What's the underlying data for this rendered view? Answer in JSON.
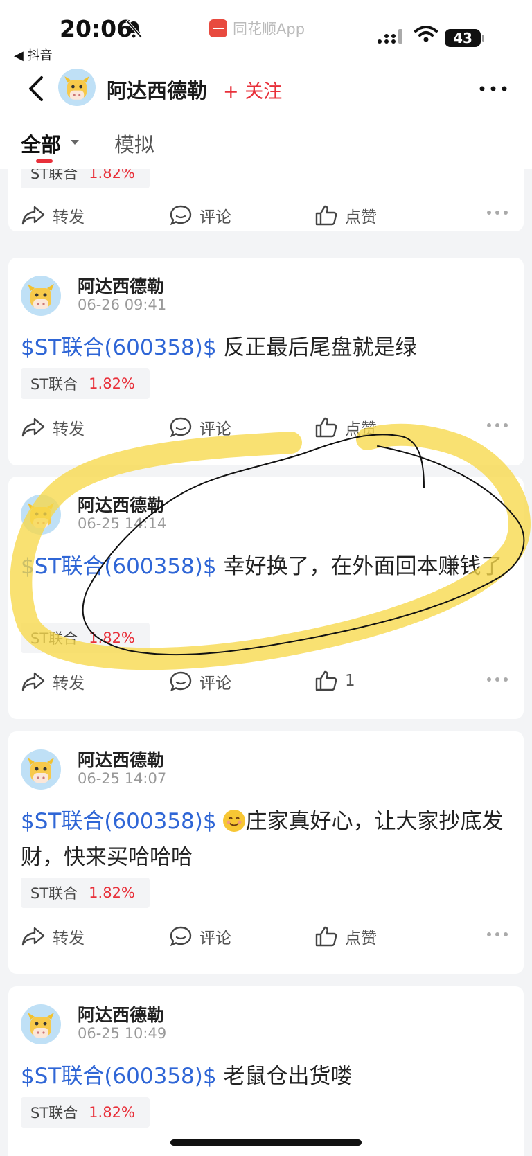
{
  "status_bar": {
    "time": "20:06",
    "back_app": "◀ 抖音",
    "app_name": "同花顺App",
    "battery": "43"
  },
  "header": {
    "username": "阿达西德勒",
    "follow_label": "+ 关注"
  },
  "tabs": {
    "all": "全部",
    "simulated": "模拟"
  },
  "actions": {
    "forward": "转发",
    "comment": "评论",
    "like": "点赞"
  },
  "stock_chip": {
    "name": "ST联合",
    "change": "1.82%"
  },
  "posts": [
    {
      "author": "阿达西德勒",
      "date": "06-26 09:41",
      "symbol": "$ST联合(600358)$",
      "text": " 反正最后尾盘就是绿",
      "chip_name": "ST联合",
      "chip_change": "1.82%",
      "like": "点赞"
    },
    {
      "author": "阿达西德勒",
      "date": "06-25 14:14",
      "symbol": "$ST联合(600358)$",
      "text": " 幸好换了，在外面回本赚钱了",
      "chip_name": "ST联合",
      "chip_change": "1.82%",
      "like": "1"
    },
    {
      "author": "阿达西德勒",
      "date": "06-25 14:07",
      "symbol": "$ST联合(600358)$",
      "text": "庄家真好心，让大家抄底发财，快来买哈哈哈",
      "chip_name": "ST联合",
      "chip_change": "1.82%",
      "like": "点赞"
    },
    {
      "author": "阿达西德勒",
      "date": "06-25 10:49",
      "symbol": "$ST联合(600358)$",
      "text": " 老鼠仓出货喽",
      "chip_name": "ST联合",
      "chip_change": "1.82%"
    }
  ],
  "colors": {
    "accent_red": "#e8303a",
    "link_blue": "#2f66d6",
    "highlight_yellow": "#f7d84a"
  }
}
